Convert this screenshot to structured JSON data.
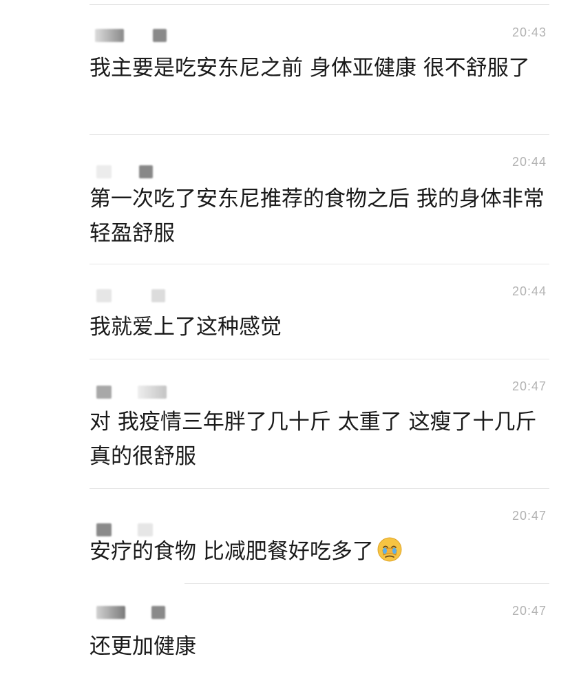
{
  "messages": [
    {
      "time": "20:43",
      "text": "我主要是吃安东尼之前 身体亚健康 很不舒服了"
    },
    {
      "time": "20:44",
      "text": "第一次吃了安东尼推荐的食物之后 我的身体非常轻盈舒服"
    },
    {
      "time": "20:44",
      "text": "我就爱上了这种感觉"
    },
    {
      "time": "20:47",
      "text": "对 我疫情三年胖了几十斤 太重了 这瘦了十几斤 真的很舒服"
    },
    {
      "time": "20:47",
      "text": "安疗的食物 比减肥餐好吃多了",
      "emoji": "face-with-hand-over-eyes-emoji"
    },
    {
      "time": "20:47",
      "text": "还更加健康"
    }
  ],
  "colors": {
    "divider": "#e6e6e6",
    "timestamp": "#b3b3b3",
    "message_text": "#1a1a1a",
    "redaction_dark": "#7a7a7a",
    "redaction_light": "#e2e2e2",
    "emoji_face": "#f6c443",
    "emoji_hand": "#f3b23a"
  }
}
